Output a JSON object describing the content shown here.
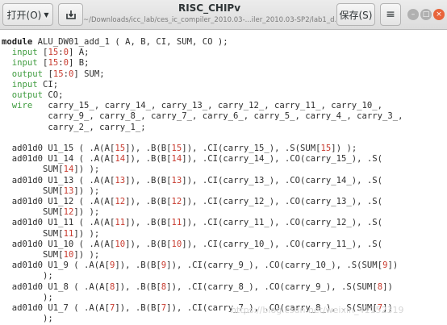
{
  "header": {
    "open_label": "打开(O)",
    "title": "RISC_CHIPv",
    "path": "~/Downloads/icc_lab/ces_ic_compiler_2010.03-...iler_2010.03-SP2/lab1_d...",
    "save_label": "保存(S)",
    "menu_glyph": "≡",
    "minimize_glyph": "–",
    "maximize_glyph": "□",
    "close_glyph": "×"
  },
  "editor": {
    "lines": [
      "module ALU_DW01_add_1 ( A, B, CI, SUM, CO );",
      "  input [15:0] A;",
      "  input [15:0] B;",
      "  output [15:0] SUM;",
      "  input CI;",
      "  output CO;",
      "  wire   carry_15_, carry_14_, carry_13_, carry_12_, carry_11_, carry_10_,",
      "         carry_9_, carry_8_, carry_7_, carry_6_, carry_5_, carry_4_, carry_3_,",
      "         carry_2_, carry_1_;",
      "",
      "  ad01d0 U1_15 ( .A(A[15]), .B(B[15]), .CI(carry_15_), .S(SUM[15]) );",
      "  ad01d0 U1_14 ( .A(A[14]), .B(B[14]), .CI(carry_14_), .CO(carry_15_), .S(",
      "        SUM[14]) );",
      "  ad01d0 U1_13 ( .A(A[13]), .B(B[13]), .CI(carry_13_), .CO(carry_14_), .S(",
      "        SUM[13]) );",
      "  ad01d0 U1_12 ( .A(A[12]), .B(B[12]), .CI(carry_12_), .CO(carry_13_), .S(",
      "        SUM[12]) );",
      "  ad01d0 U1_11 ( .A(A[11]), .B(B[11]), .CI(carry_11_), .CO(carry_12_), .S(",
      "        SUM[11]) );",
      "  ad01d0 U1_10 ( .A(A[10]), .B(B[10]), .CI(carry_10_), .CO(carry_11_), .S(",
      "        SUM[10]) );",
      "  ad01d0 U1_9 ( .A(A[9]), .B(B[9]), .CI(carry_9_), .CO(carry_10_), .S(SUM[9])",
      "        );",
      "  ad01d0 U1_8 ( .A(A[8]), .B(B[8]), .CI(carry_8_), .CO(carry_9_), .S(SUM[8])",
      "        );",
      "  ad01d0 U1_7 ( .A(A[7]), .B(B[7]), .CI(carry_7_), .CO(carry_8_), .S(SUM[7])",
      "        );"
    ],
    "watermark": "https://blog.csdn.net/weixin_41152319"
  },
  "colors": {
    "keyword": "#3f9c3f",
    "number": "#c83b2f",
    "close_button": "#e8643b"
  }
}
